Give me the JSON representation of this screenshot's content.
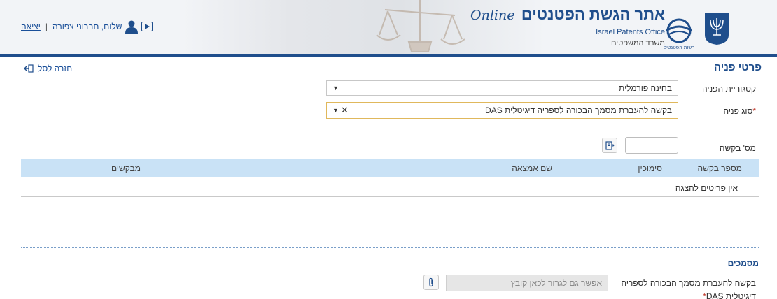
{
  "header": {
    "user": {
      "logout_label": "יציאה",
      "separator": "|",
      "greeting": "שלום, חברוני צפורה"
    },
    "brand": {
      "title": "אתר הגשת הפטנטים",
      "online": "Online",
      "subtitle_en": "Israel Patents Office",
      "subtitle_he": "משרד המשפטים",
      "logo_caption": "רשות הפטנטים"
    }
  },
  "page": {
    "title": "פרטי פניה",
    "back_label": "חזרה לסל"
  },
  "form": {
    "category": {
      "label": "קטגוריית הפניה",
      "value": "בחינה פורמלית"
    },
    "request_type": {
      "label": "סוג פניה",
      "required_mark": "*",
      "value": "בקשה להעברת מסמך הבכורה לספריה דיגיטלית DAS"
    },
    "request_number": {
      "label": "מס' בקשה",
      "value": ""
    }
  },
  "table": {
    "columns": [
      "מספר בקשה",
      "סימוכין",
      "שם אמצאה",
      "מבקשים"
    ],
    "empty_text": "אין פריטים להצגה"
  },
  "documents": {
    "title": "מסמכים",
    "item_label": "בקשה להעברת מסמך הבכורה לספריה דיגיטלית DAS",
    "required_mark": "*",
    "upload_placeholder": "אפשר גם לגרור לכאן קובץ"
  },
  "colors": {
    "brand_blue": "#1f4e8c",
    "table_header": "#c9e2f6",
    "focus_border": "#e0b85c"
  }
}
